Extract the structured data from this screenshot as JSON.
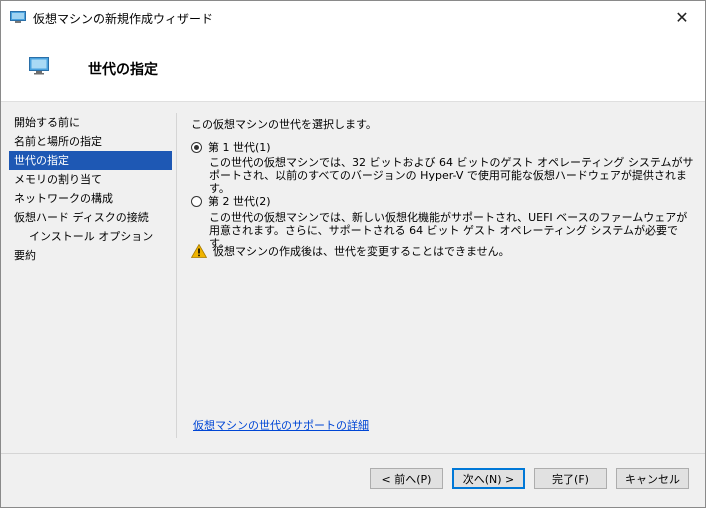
{
  "window": {
    "title": "仮想マシンの新規作成ウィザード",
    "close_glyph": "✕"
  },
  "header": {
    "title": "世代の指定"
  },
  "nav": {
    "items": [
      {
        "label": "開始する前に"
      },
      {
        "label": "名前と場所の指定"
      },
      {
        "label": "世代の指定"
      },
      {
        "label": "メモリの割り当て"
      },
      {
        "label": "ネットワークの構成"
      },
      {
        "label": "仮想ハード ディスクの接続"
      },
      {
        "label": "インストール オプション"
      },
      {
        "label": "要約"
      }
    ],
    "active_index": 2
  },
  "content": {
    "instruction": "この仮想マシンの世代を選択します。",
    "gen1": {
      "label": "第 1 世代(1)",
      "selected": true,
      "description": "この世代の仮想マシンでは、32 ビットおよび 64 ビットのゲスト オペレーティング システムがサポートされ、以前のすべてのバージョンの Hyper-V で使用可能な仮想ハードウェアが提供されます。"
    },
    "gen2": {
      "label": "第 2 世代(2)",
      "selected": false,
      "description": "この世代の仮想マシンでは、新しい仮想化機能がサポートされ、UEFI ベースのファームウェアが用意されます。さらに、サポートされる 64 ビット ゲスト オペレーティング システムが必要です。"
    },
    "warning": "仮想マシンの作成後は、世代を変更することはできません。",
    "link": "仮想マシンの世代のサポートの詳細"
  },
  "buttons": {
    "back": "< 前へ(P)",
    "next": "次へ(N) >",
    "finish": "完了(F)",
    "cancel": "キャンセル"
  },
  "colors": {
    "selection": "#1e58b4",
    "link": "#0046d5",
    "warning": "#f0b400"
  }
}
